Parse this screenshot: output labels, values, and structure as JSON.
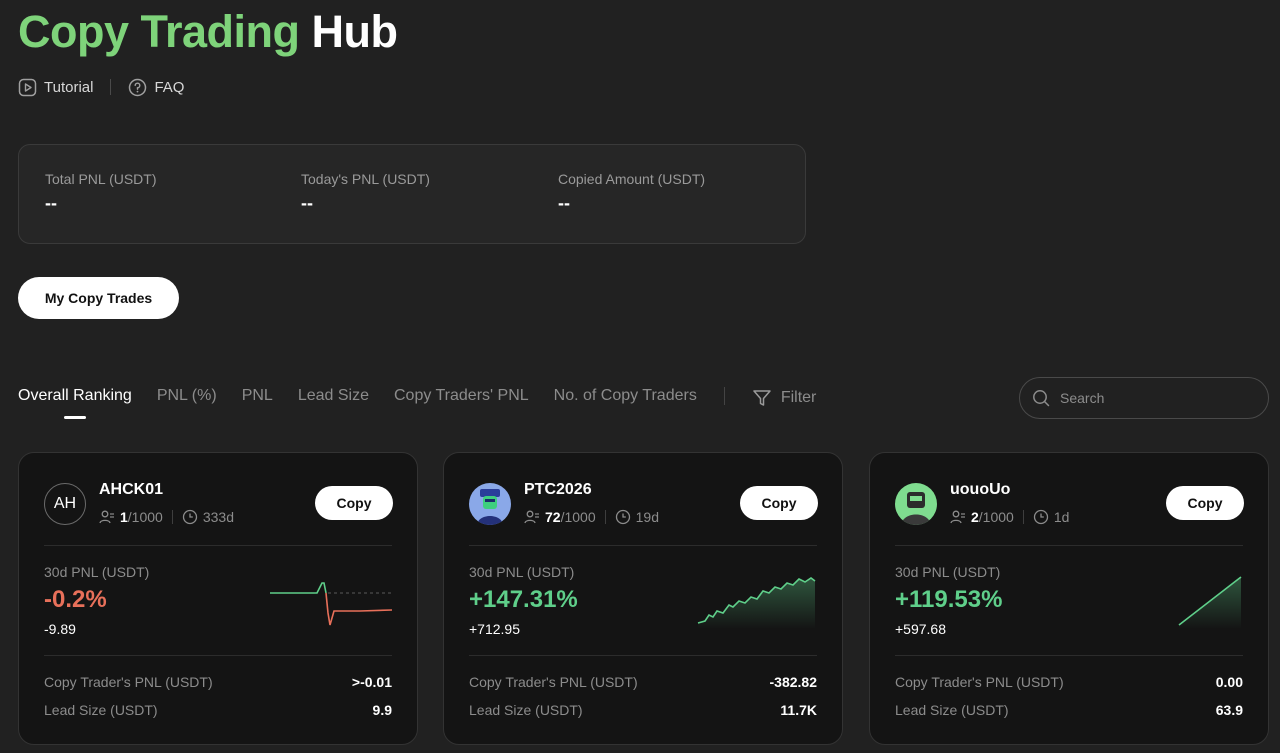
{
  "header": {
    "title_accent": "Copy Trading",
    "title_rest": "Hub",
    "tutorial_label": "Tutorial",
    "faq_label": "FAQ"
  },
  "stats": [
    {
      "label": "Total PNL (USDT)",
      "value": "--"
    },
    {
      "label": "Today's PNL (USDT)",
      "value": "--"
    },
    {
      "label": "Copied Amount (USDT)",
      "value": "--"
    }
  ],
  "my_copy_trades_label": "My Copy Trades",
  "tabs": [
    "Overall Ranking",
    "PNL (%)",
    "PNL",
    "Lead Size",
    "Copy Traders' PNL",
    "No. of Copy Traders"
  ],
  "active_tab": "Overall Ranking",
  "filter_label": "Filter",
  "search": {
    "placeholder": "Search"
  },
  "cards": [
    {
      "name": "AHCK01",
      "avatar_initials": "AH",
      "copiers": "1",
      "copiers_max": "/1000",
      "days": "333d",
      "copy_label": "Copy",
      "pnl_label": "30d PNL (USDT)",
      "pnl_pct": "-0.2%",
      "pnl_abs": "-9.89",
      "copy_traders_pnl_label": "Copy Trader's PNL (USDT)",
      "copy_traders_pnl": ">-0.01",
      "lead_size_label": "Lead Size (USDT)",
      "lead_size": "9.9"
    },
    {
      "name": "PTC2026",
      "avatar_icon": "robot-avatar-icon",
      "copiers": "72",
      "copiers_max": "/1000",
      "days": "19d",
      "copy_label": "Copy",
      "pnl_label": "30d PNL (USDT)",
      "pnl_pct": "+147.31%",
      "pnl_abs": "+712.95",
      "copy_traders_pnl_label": "Copy Trader's PNL (USDT)",
      "copy_traders_pnl": "-382.82",
      "lead_size_label": "Lead Size (USDT)",
      "lead_size": "11.7K"
    },
    {
      "name": "uouoUo",
      "avatar_icon": "robot-avatar-icon",
      "copiers": "2",
      "copiers_max": "/1000",
      "days": "1d",
      "copy_label": "Copy",
      "pnl_label": "30d PNL (USDT)",
      "pnl_pct": "+119.53%",
      "pnl_abs": "+597.68",
      "copy_traders_pnl_label": "Copy Trader's PNL (USDT)",
      "copy_traders_pnl": "0.00",
      "lead_size_label": "Lead Size (USDT)",
      "lead_size": "63.9"
    }
  ],
  "colors": {
    "accent": "#7ed37a",
    "positive": "#5fcf8a",
    "negative": "#e8705a",
    "background": "#212121",
    "card": "#141414"
  }
}
